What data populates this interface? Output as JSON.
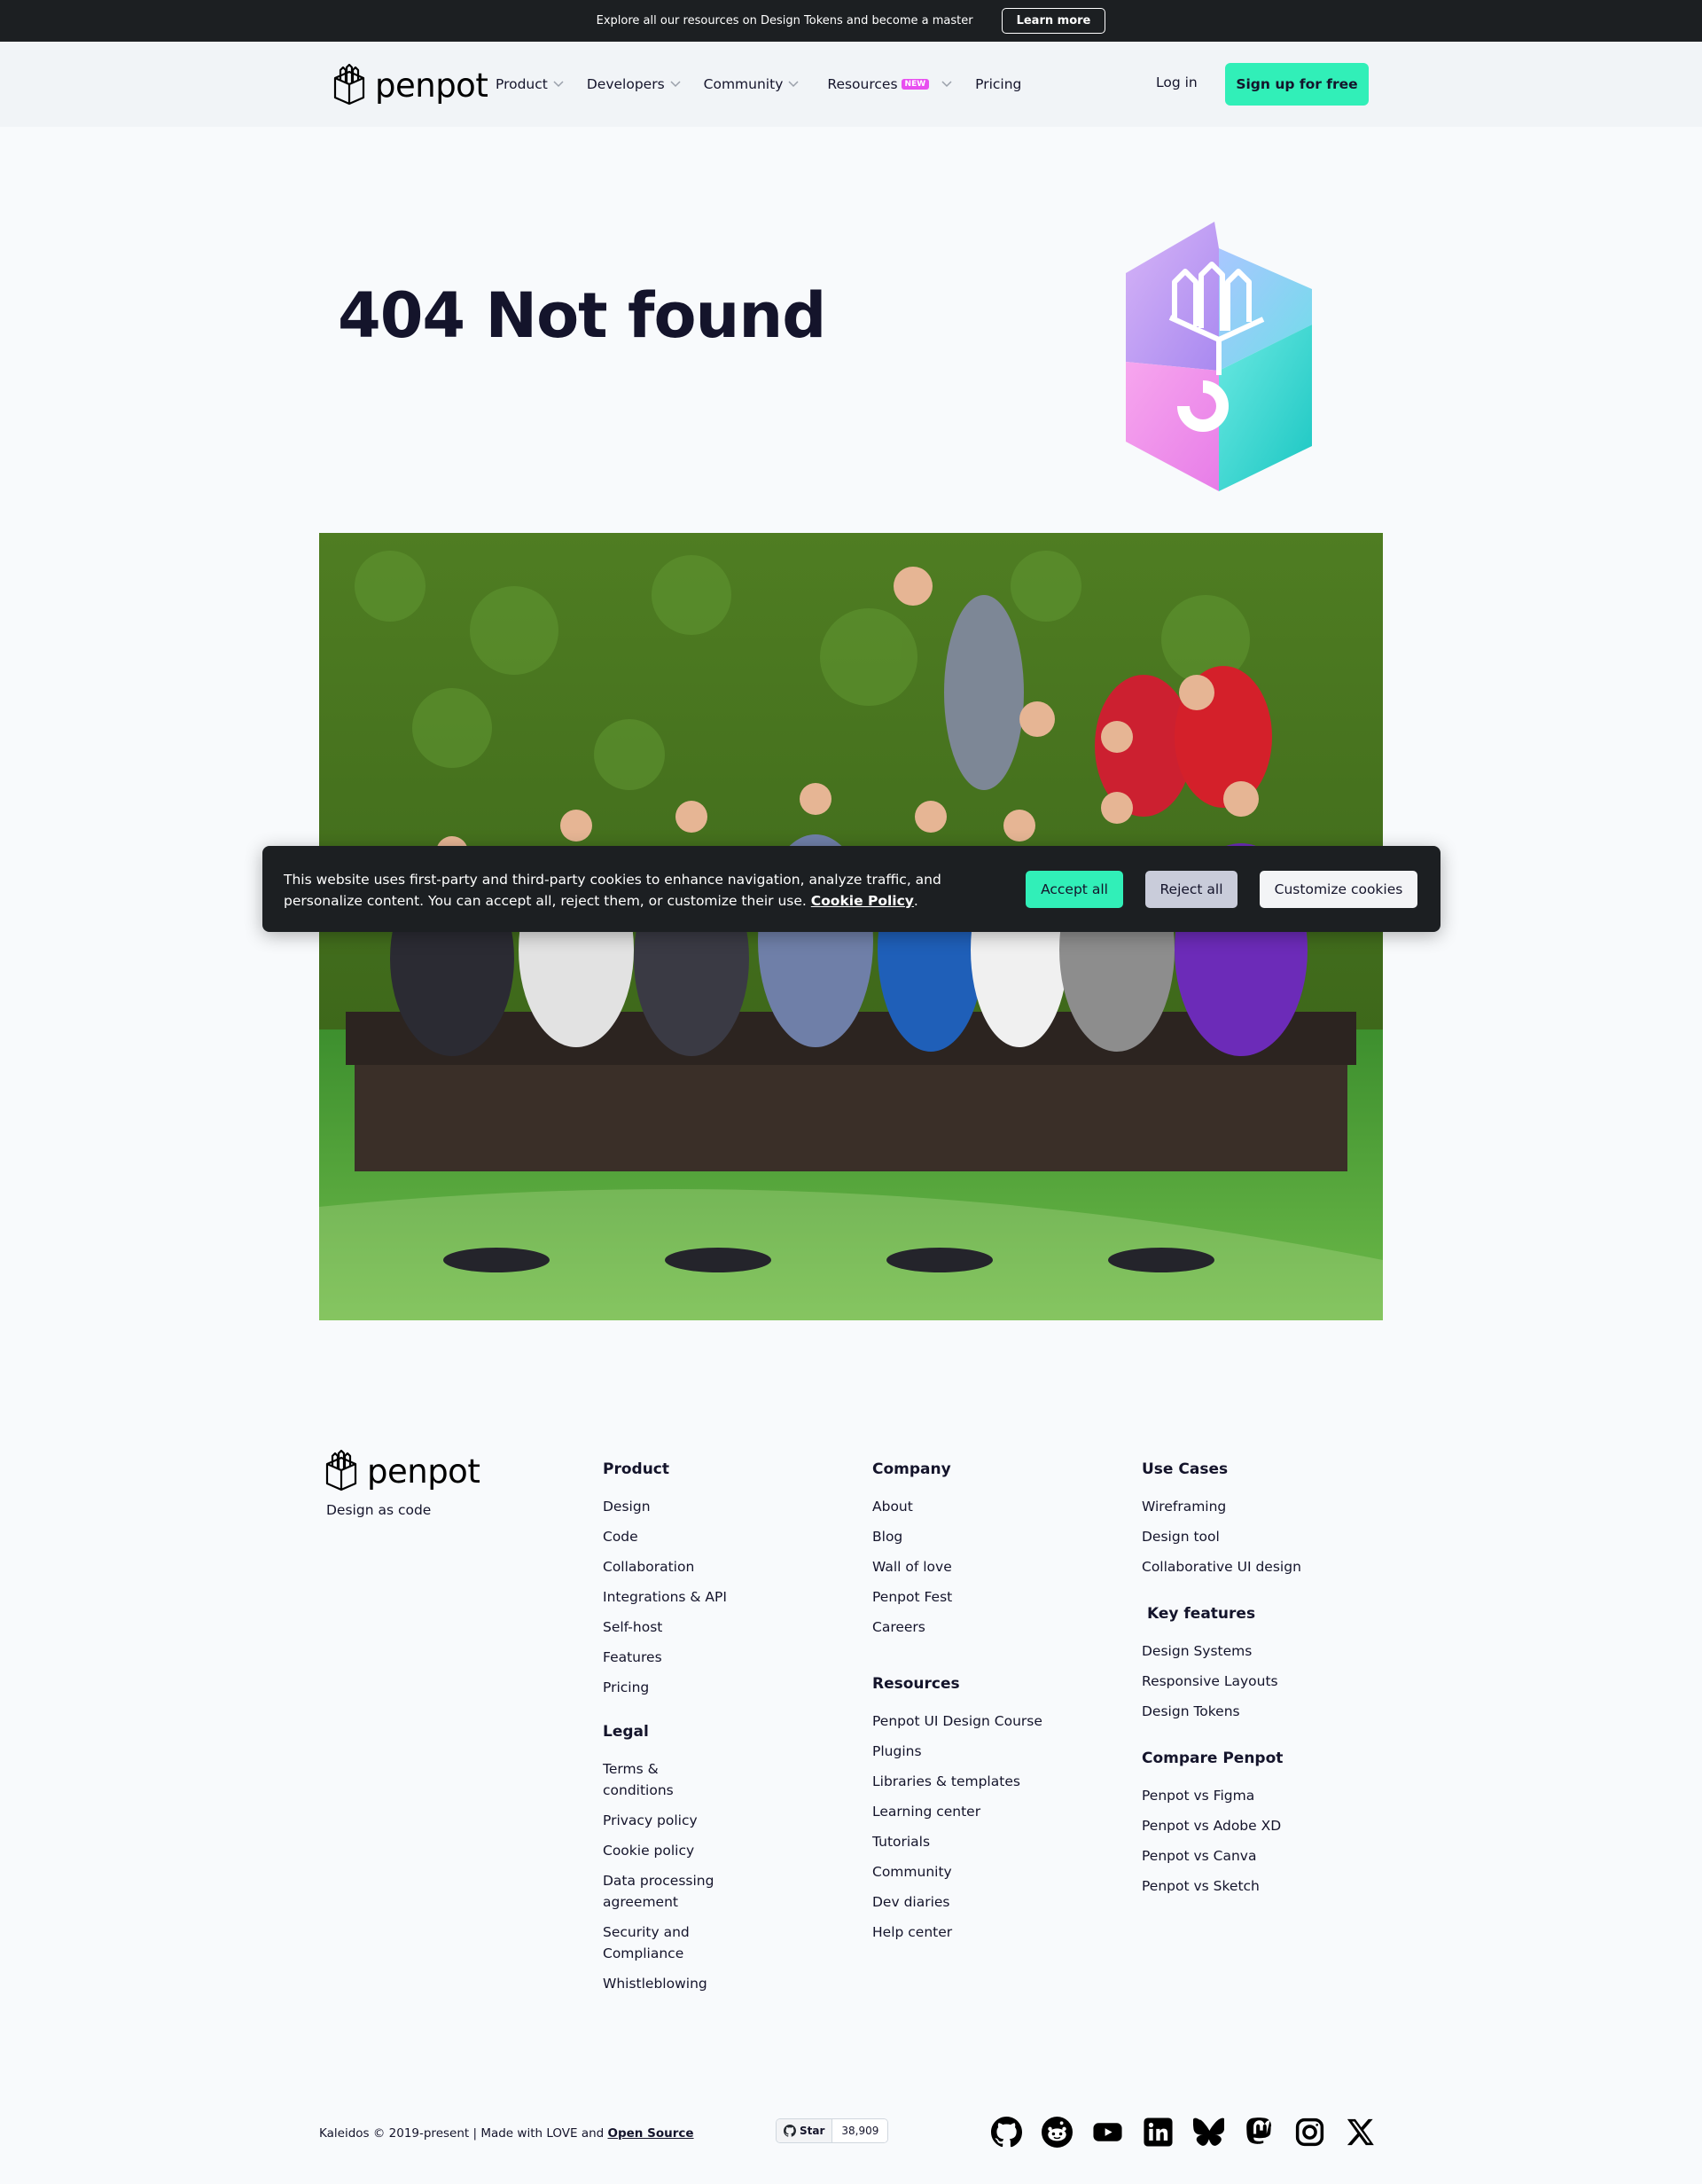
{
  "announcement": {
    "text": "Explore all our resources on Design Tokens and become a master",
    "button": "Learn more"
  },
  "header": {
    "logo_text": "penpot",
    "nav": [
      {
        "label": "Product",
        "has_dropdown": true
      },
      {
        "label": "Developers",
        "has_dropdown": true
      },
      {
        "label": "Community",
        "has_dropdown": true
      },
      {
        "label": "Resources",
        "badge": "NEW",
        "has_dropdown": true
      },
      {
        "label": "Pricing",
        "has_dropdown": false
      }
    ],
    "login": "Log in",
    "signup": "Sign up for free"
  },
  "hero": {
    "title": "404 Not found"
  },
  "cookie": {
    "text": "This website uses first-party and third-party cookies to enhance navigation, analyze traffic, and personalize content. You can accept all, reject them, or customize their use.",
    "link": "Cookie Policy",
    "accept": "Accept all",
    "reject": "Reject all",
    "customize": "Customize cookies"
  },
  "footer": {
    "logo_text": "penpot",
    "tagline": "Design as code",
    "product": {
      "title": "Product",
      "links": [
        "Design",
        "Code",
        "Collaboration",
        "Integrations & API",
        "Self-host",
        "Features",
        "Pricing"
      ]
    },
    "legal": {
      "title": "Legal",
      "links": [
        "Terms &\nconditions",
        "Privacy policy",
        "Cookie policy",
        "Data processing\nagreement",
        "Security and\nCompliance",
        "Whistleblowing"
      ]
    },
    "company": {
      "title": "Company",
      "links": [
        "About",
        "Blog",
        "Wall of love",
        "Penpot Fest",
        "Careers"
      ]
    },
    "resources": {
      "title": "Resources",
      "links": [
        "Penpot UI Design Course",
        "Plugins",
        "Libraries & templates",
        "Learning center",
        "Tutorials",
        "Community",
        "Dev diaries",
        "Help center"
      ]
    },
    "use_cases": {
      "title": "Use Cases",
      "links": [
        "Wireframing",
        "Design tool",
        "Collaborative UI design"
      ]
    },
    "key_features": {
      "title": "Key features",
      "links": [
        "Design Systems",
        "Responsive Layouts",
        "Design Tokens"
      ]
    },
    "compare": {
      "title": "Compare Penpot",
      "links": [
        "Penpot vs Figma",
        "Penpot vs Adobe XD",
        "Penpot vs Canva",
        "Penpot vs Sketch"
      ]
    },
    "copyright_prefix": "Kaleidos © 2019-present | Made with LOVE and ",
    "copyright_link": "Open Source",
    "github": {
      "label": "Star",
      "count": "38,909"
    },
    "socials": [
      "github-icon",
      "reddit-icon",
      "youtube-icon",
      "linkedin-icon",
      "bluesky-icon",
      "mastodon-icon",
      "instagram-icon",
      "x-icon"
    ]
  },
  "colors": {
    "accent": "#31efb8",
    "dark": "#1c1f22",
    "text": "#14142b",
    "badge": "#e84ff0"
  }
}
